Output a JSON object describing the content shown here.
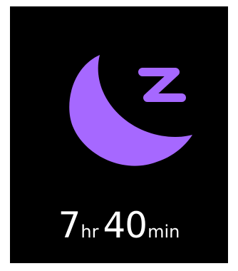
{
  "app": {
    "screen": "sleep-summary"
  },
  "icon": {
    "name": "sleep-moon-icon",
    "color": "#A668FF"
  },
  "duration": {
    "hours": "7",
    "hours_unit": "hr",
    "minutes": "40",
    "minutes_unit": "min"
  }
}
